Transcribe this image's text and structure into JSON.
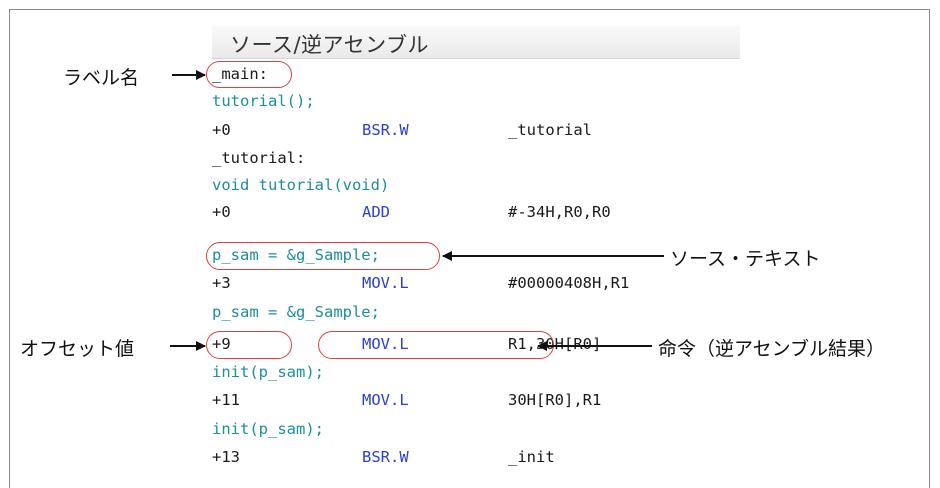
{
  "panel": {
    "title": "ソース/逆アセンブル"
  },
  "code_lines": [
    {
      "kind": "label",
      "text": "_main:"
    },
    {
      "kind": "source",
      "text": "tutorial();"
    },
    {
      "kind": "asm",
      "offset": "+0",
      "opcode": "BSR.W",
      "operand": "_tutorial"
    },
    {
      "kind": "label",
      "text": "_tutorial:"
    },
    {
      "kind": "source",
      "text": "void tutorial(void)"
    },
    {
      "kind": "asm",
      "offset": "+0",
      "opcode": "ADD",
      "operand": "#-34H,R0,R0"
    },
    {
      "kind": "source",
      "text": "p_sam = &g_Sample;"
    },
    {
      "kind": "asm",
      "offset": "+3",
      "opcode": "MOV.L",
      "operand": "#00000408H,R1"
    },
    {
      "kind": "source",
      "text": "p_sam = &g_Sample;"
    },
    {
      "kind": "asm",
      "offset": "+9",
      "opcode": "MOV.L",
      "operand": "R1,30H[R0]"
    },
    {
      "kind": "source",
      "text": "init(p_sam);"
    },
    {
      "kind": "asm",
      "offset": "+11",
      "opcode": "MOV.L",
      "operand": "30H[R0],R1"
    },
    {
      "kind": "source",
      "text": "init(p_sam);"
    },
    {
      "kind": "asm",
      "offset": "+13",
      "opcode": "BSR.W",
      "operand": "_init"
    }
  ],
  "annotations": {
    "label_name": "ラベル名",
    "source_text": "ソース・テキスト",
    "offset_value": "オフセット値",
    "instruction": "命令（逆アセンブル結果）"
  },
  "colors": {
    "source_text": "#1c8e9e",
    "opcode": "#2a3fd0",
    "highlight_oval": "#e04040"
  }
}
